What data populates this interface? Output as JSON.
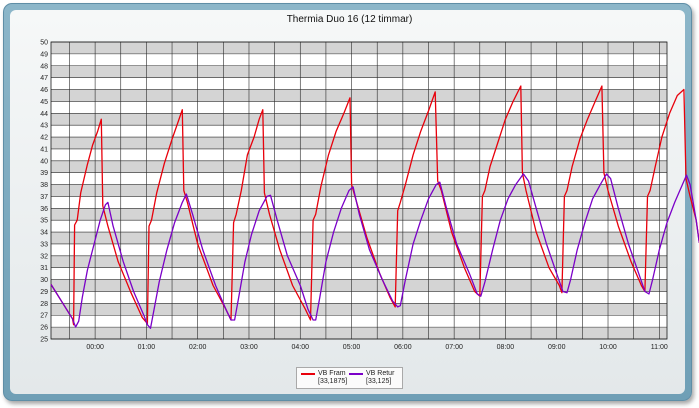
{
  "chart_data": {
    "type": "line",
    "title": "Thermia Duo 16 (12 timmar)",
    "xlabel": "",
    "ylabel": "",
    "ylim": [
      25,
      50
    ],
    "yticks": [
      25,
      26,
      27,
      28,
      29,
      30,
      31,
      32,
      33,
      34,
      35,
      36,
      37,
      38,
      39,
      40,
      41,
      42,
      43,
      44,
      45,
      46,
      47,
      48,
      49,
      50
    ],
    "x_unit": "hours",
    "xlim": [
      -0.86,
      11.15
    ],
    "xticks": [
      {
        "value": 0,
        "label": "00:00"
      },
      {
        "value": 1,
        "label": "01:00"
      },
      {
        "value": 2,
        "label": "02:00"
      },
      {
        "value": 3,
        "label": "03:00"
      },
      {
        "value": 4,
        "label": "04:00"
      },
      {
        "value": 5,
        "label": "05:00"
      },
      {
        "value": 6,
        "label": "06:00"
      },
      {
        "value": 7,
        "label": "07:00"
      },
      {
        "value": 8,
        "label": "08:00"
      },
      {
        "value": 9,
        "label": "09:00"
      },
      {
        "value": 10,
        "label": "10:00"
      },
      {
        "value": 11,
        "label": "11:00"
      }
    ],
    "grid": true,
    "background_bands": "alternating grey/white per 1 unit",
    "legend_position": "bottom-center",
    "series": [
      {
        "name": "VB Fram",
        "legend_value": "[33,1875]",
        "color": "#e8000b",
        "points": [
          [
            -0.86,
            29.6
          ],
          [
            -0.6,
            27.8
          ],
          [
            -0.44,
            26.7
          ],
          [
            -0.42,
            26.2
          ],
          [
            -0.4,
            34.6
          ],
          [
            -0.35,
            35.0
          ],
          [
            -0.28,
            37.3
          ],
          [
            -0.15,
            39.7
          ],
          [
            -0.05,
            41.3
          ],
          [
            0.05,
            42.5
          ],
          [
            0.12,
            43.5
          ],
          [
            0.15,
            36.2
          ],
          [
            0.25,
            34.5
          ],
          [
            0.45,
            31.5
          ],
          [
            0.7,
            28.9
          ],
          [
            0.92,
            26.8
          ],
          [
            1.02,
            26.3
          ],
          [
            1.05,
            34.5
          ],
          [
            1.1,
            35.0
          ],
          [
            1.2,
            37.3
          ],
          [
            1.35,
            39.8
          ],
          [
            1.5,
            41.8
          ],
          [
            1.62,
            43.3
          ],
          [
            1.7,
            44.3
          ],
          [
            1.73,
            37.5
          ],
          [
            1.8,
            36.5
          ],
          [
            2.0,
            33.0
          ],
          [
            2.3,
            29.5
          ],
          [
            2.55,
            27.5
          ],
          [
            2.65,
            26.6
          ],
          [
            2.7,
            34.8
          ],
          [
            2.75,
            35.5
          ],
          [
            2.85,
            37.5
          ],
          [
            2.97,
            40.5
          ],
          [
            3.1,
            42.0
          ],
          [
            3.2,
            43.5
          ],
          [
            3.27,
            44.3
          ],
          [
            3.3,
            37.3
          ],
          [
            3.4,
            35.5
          ],
          [
            3.6,
            32.5
          ],
          [
            3.85,
            29.5
          ],
          [
            4.1,
            27.5
          ],
          [
            4.2,
            26.6
          ],
          [
            4.25,
            35.0
          ],
          [
            4.3,
            35.5
          ],
          [
            4.4,
            37.8
          ],
          [
            4.55,
            40.5
          ],
          [
            4.7,
            42.5
          ],
          [
            4.85,
            44.0
          ],
          [
            4.97,
            45.3
          ],
          [
            5.0,
            38.0
          ],
          [
            5.1,
            36.5
          ],
          [
            5.3,
            33.5
          ],
          [
            5.55,
            30.5
          ],
          [
            5.75,
            28.5
          ],
          [
            5.85,
            27.7
          ],
          [
            5.9,
            35.8
          ],
          [
            5.95,
            36.5
          ],
          [
            6.05,
            38.0
          ],
          [
            6.2,
            40.5
          ],
          [
            6.35,
            42.5
          ],
          [
            6.5,
            44.2
          ],
          [
            6.63,
            45.8
          ],
          [
            6.68,
            38.3
          ],
          [
            6.75,
            37.5
          ],
          [
            6.95,
            34.0
          ],
          [
            7.2,
            31.0
          ],
          [
            7.4,
            29.0
          ],
          [
            7.5,
            28.6
          ],
          [
            7.55,
            37.0
          ],
          [
            7.6,
            37.5
          ],
          [
            7.7,
            39.5
          ],
          [
            7.85,
            41.5
          ],
          [
            8.0,
            43.5
          ],
          [
            8.15,
            45.0
          ],
          [
            8.3,
            46.3
          ],
          [
            8.33,
            39.0
          ],
          [
            8.4,
            37.5
          ],
          [
            8.6,
            34.0
          ],
          [
            8.85,
            31.0
          ],
          [
            9.05,
            29.5
          ],
          [
            9.1,
            28.9
          ],
          [
            9.15,
            37.0
          ],
          [
            9.2,
            37.5
          ],
          [
            9.3,
            39.5
          ],
          [
            9.45,
            41.8
          ],
          [
            9.6,
            43.5
          ],
          [
            9.75,
            45.0
          ],
          [
            9.88,
            46.3
          ],
          [
            9.92,
            39.0
          ],
          [
            10.0,
            37.5
          ],
          [
            10.2,
            34.5
          ],
          [
            10.45,
            31.5
          ],
          [
            10.65,
            29.5
          ],
          [
            10.72,
            29.0
          ],
          [
            10.77,
            37.0
          ],
          [
            10.82,
            37.5
          ],
          [
            10.92,
            39.5
          ],
          [
            11.05,
            42.0
          ],
          [
            11.2,
            44.0
          ],
          [
            11.35,
            45.5
          ],
          [
            11.48,
            46.0
          ],
          [
            11.52,
            38.5
          ],
          [
            11.6,
            37.0
          ],
          [
            11.72,
            35.0
          ],
          [
            11.78,
            33.1
          ]
        ]
      },
      {
        "name": "VB Retur",
        "legend_value": "[33,125]",
        "color": "#7b00c8",
        "points": [
          [
            -0.86,
            29.6
          ],
          [
            -0.6,
            27.8
          ],
          [
            -0.44,
            26.7
          ],
          [
            -0.38,
            26.0
          ],
          [
            -0.32,
            26.5
          ],
          [
            -0.25,
            28.5
          ],
          [
            -0.15,
            30.8
          ],
          [
            -0.02,
            33.0
          ],
          [
            0.1,
            35.0
          ],
          [
            0.2,
            36.3
          ],
          [
            0.25,
            36.5
          ],
          [
            0.35,
            34.5
          ],
          [
            0.55,
            31.5
          ],
          [
            0.75,
            29.0
          ],
          [
            0.95,
            27.0
          ],
          [
            1.02,
            26.2
          ],
          [
            1.08,
            25.9
          ],
          [
            1.15,
            27.5
          ],
          [
            1.25,
            29.8
          ],
          [
            1.4,
            32.5
          ],
          [
            1.55,
            34.8
          ],
          [
            1.7,
            36.5
          ],
          [
            1.78,
            37.2
          ],
          [
            1.9,
            35.5
          ],
          [
            2.1,
            32.5
          ],
          [
            2.35,
            29.5
          ],
          [
            2.55,
            27.5
          ],
          [
            2.65,
            26.6
          ],
          [
            2.72,
            26.6
          ],
          [
            2.8,
            28.5
          ],
          [
            2.92,
            31.5
          ],
          [
            3.05,
            33.8
          ],
          [
            3.2,
            35.8
          ],
          [
            3.35,
            37.0
          ],
          [
            3.42,
            37.1
          ],
          [
            3.55,
            35.0
          ],
          [
            3.75,
            32.0
          ],
          [
            4.0,
            29.5
          ],
          [
            4.15,
            27.5
          ],
          [
            4.25,
            26.6
          ],
          [
            4.3,
            26.6
          ],
          [
            4.38,
            28.5
          ],
          [
            4.5,
            31.5
          ],
          [
            4.65,
            34.0
          ],
          [
            4.8,
            36.0
          ],
          [
            4.95,
            37.5
          ],
          [
            5.03,
            37.8
          ],
          [
            5.15,
            35.5
          ],
          [
            5.35,
            32.5
          ],
          [
            5.6,
            30.0
          ],
          [
            5.8,
            28.2
          ],
          [
            5.9,
            27.7
          ],
          [
            5.95,
            27.8
          ],
          [
            6.05,
            30.0
          ],
          [
            6.2,
            33.0
          ],
          [
            6.35,
            35.0
          ],
          [
            6.5,
            36.8
          ],
          [
            6.65,
            38.0
          ],
          [
            6.72,
            38.2
          ],
          [
            6.85,
            36.0
          ],
          [
            7.05,
            33.0
          ],
          [
            7.3,
            30.5
          ],
          [
            7.45,
            28.8
          ],
          [
            7.52,
            28.6
          ],
          [
            7.6,
            29.8
          ],
          [
            7.75,
            32.5
          ],
          [
            7.9,
            35.0
          ],
          [
            8.05,
            36.8
          ],
          [
            8.2,
            38.0
          ],
          [
            8.35,
            38.9
          ],
          [
            8.45,
            38.3
          ],
          [
            8.6,
            36.0
          ],
          [
            8.8,
            33.0
          ],
          [
            9.0,
            30.5
          ],
          [
            9.12,
            29.0
          ],
          [
            9.2,
            28.9
          ],
          [
            9.27,
            30.0
          ],
          [
            9.4,
            32.5
          ],
          [
            9.55,
            34.8
          ],
          [
            9.7,
            36.8
          ],
          [
            9.85,
            38.0
          ],
          [
            9.97,
            38.9
          ],
          [
            10.05,
            38.5
          ],
          [
            10.2,
            36.0
          ],
          [
            10.4,
            33.0
          ],
          [
            10.6,
            30.5
          ],
          [
            10.72,
            29.0
          ],
          [
            10.8,
            28.8
          ],
          [
            10.87,
            30.0
          ],
          [
            11.0,
            32.5
          ],
          [
            11.15,
            34.8
          ],
          [
            11.3,
            36.5
          ],
          [
            11.45,
            38.0
          ],
          [
            11.53,
            38.8
          ],
          [
            11.6,
            38.0
          ],
          [
            11.72,
            35.0
          ],
          [
            11.78,
            33.1
          ]
        ]
      }
    ]
  }
}
